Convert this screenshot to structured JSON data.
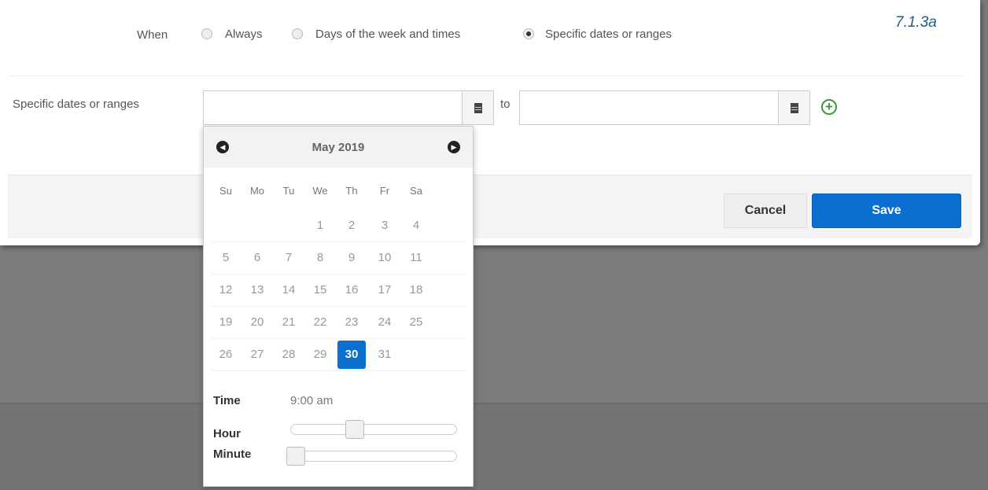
{
  "figure_label": "7.1.3a",
  "when": {
    "label": "When",
    "options": [
      "Always",
      "Days of the week and times",
      "Specific dates or ranges"
    ],
    "selected_index": 2
  },
  "dates": {
    "label": "Specific dates or ranges",
    "start_value": "",
    "to_label": "to",
    "end_value": "",
    "add_icon": "plus-circle-icon",
    "calendar_icon": "calendar-icon"
  },
  "footer": {
    "cancel_label": "Cancel",
    "save_label": "Save"
  },
  "datepicker": {
    "month_label": "May 2019",
    "prev_icon": "chevron-left-icon",
    "next_icon": "chevron-right-icon",
    "weekdays": [
      "Su",
      "Mo",
      "Tu",
      "We",
      "Th",
      "Fr",
      "Sa"
    ],
    "weeks": [
      [
        "",
        "",
        "",
        "1",
        "2",
        "3",
        "4"
      ],
      [
        "5",
        "6",
        "7",
        "8",
        "9",
        "10",
        "11"
      ],
      [
        "12",
        "13",
        "14",
        "15",
        "16",
        "17",
        "18"
      ],
      [
        "19",
        "20",
        "21",
        "22",
        "23",
        "24",
        "25"
      ],
      [
        "26",
        "27",
        "28",
        "29",
        "30",
        "31",
        ""
      ]
    ],
    "selected_day": "30",
    "time_label": "Time",
    "time_value": "9:00 am",
    "hour_label": "Hour",
    "hour_slider_fraction": 0.38,
    "minute_label": "Minute",
    "minute_slider_fraction": 0.0
  },
  "colors": {
    "accent": "#0b6fd0",
    "add_icon": "#3a9a3a"
  }
}
